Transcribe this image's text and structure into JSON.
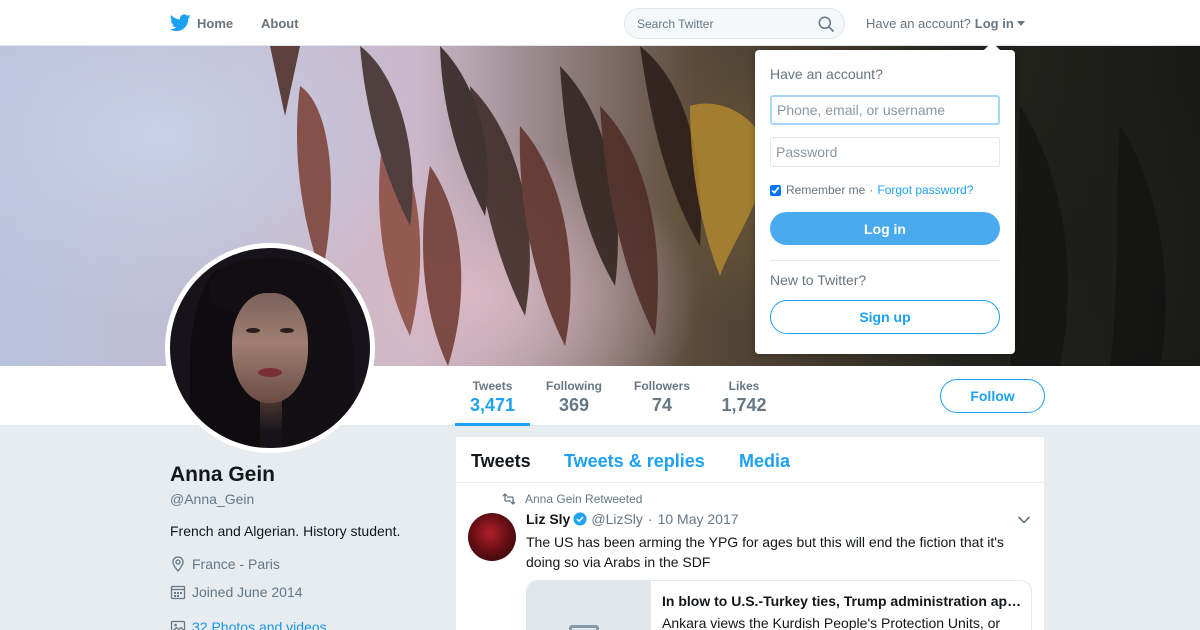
{
  "nav": {
    "home_label": "Home",
    "about_label": "About",
    "search_placeholder": "Search Twitter",
    "have_account": "Have an account?",
    "login_label": "Log in"
  },
  "profile": {
    "name": "Anna Gein",
    "handle": "@Anna_Gein",
    "bio": "French and Algerian. History student.",
    "location": "France - Paris",
    "joined": "Joined June 2014",
    "photos_link": "32 Photos and videos"
  },
  "stats": [
    {
      "label": "Tweets",
      "value": "3,471"
    },
    {
      "label": "Following",
      "value": "369"
    },
    {
      "label": "Followers",
      "value": "74"
    },
    {
      "label": "Likes",
      "value": "1,742"
    }
  ],
  "follow_label": "Follow",
  "tabs": [
    "Tweets",
    "Tweets & replies",
    "Media"
  ],
  "tweet": {
    "retweet_context": "Anna Gein Retweeted",
    "author_name": "Liz Sly",
    "author_handle": "@LizSly",
    "date": "10 May 2017",
    "text": "The US has been arming the YPG for ages but this will end the fiction that it's doing so via Arabs in the SDF",
    "card_title": "In blow to U.S.-Turkey ties, Trump administration approves",
    "card_desc": "Ankara views the Kurdish People's Protection Units, or"
  },
  "login_dropdown": {
    "title": "Have an account?",
    "username_placeholder": "Phone, email, or username",
    "password_placeholder": "Password",
    "remember_label": "Remember me",
    "separator": "·",
    "forgot_label": "Forgot password?",
    "login_button": "Log in",
    "new_prompt": "New to Twitter?",
    "signup_button": "Sign up"
  },
  "colors": {
    "accent": "#1da1f2",
    "login_button": "#4aaaee",
    "background": "#e6ecf0"
  },
  "icons": [
    "twitter-bird-icon",
    "search-icon",
    "chevron-down-icon",
    "location-pin-icon",
    "calendar-icon",
    "photo-icon",
    "retweet-icon",
    "verified-badge-icon"
  ]
}
